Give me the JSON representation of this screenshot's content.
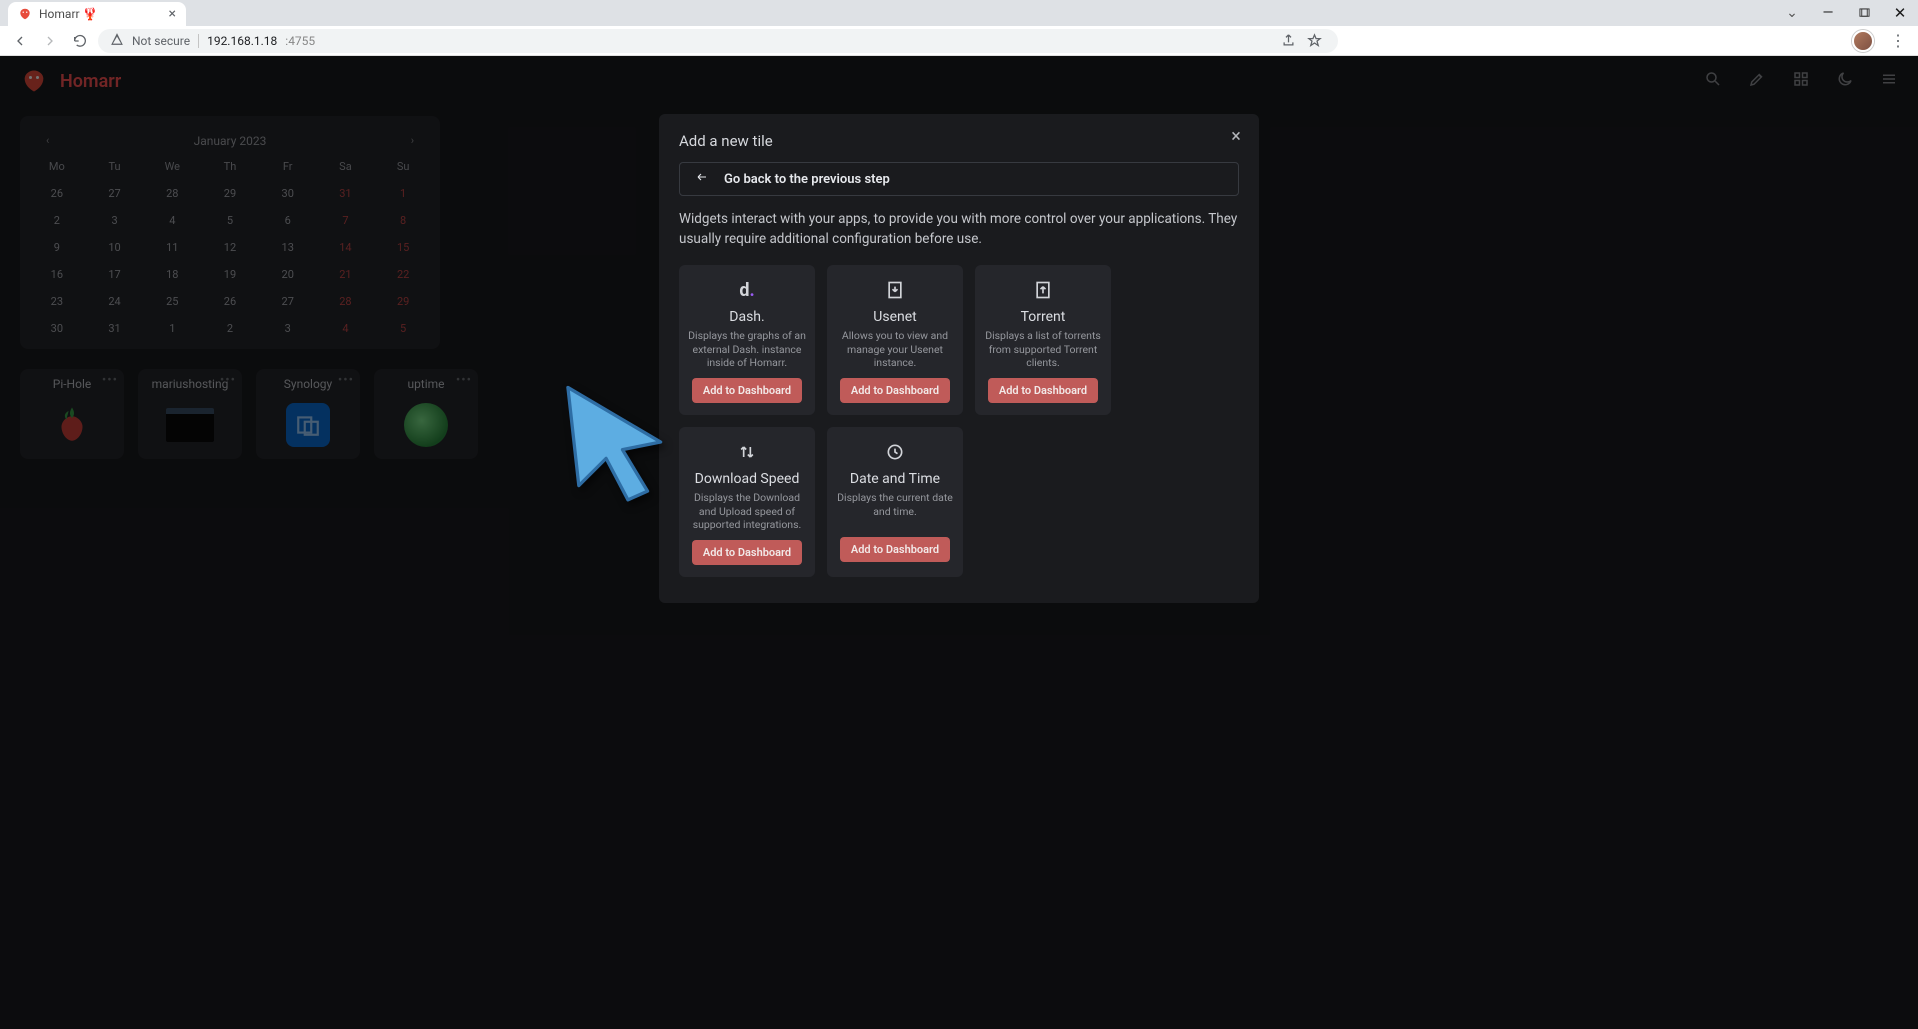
{
  "browser": {
    "tab_title": "Homarr 🦞",
    "security_label": "Not secure",
    "address_host": "192.168.1.18",
    "address_port": ":4755"
  },
  "header": {
    "brand": "Homarr",
    "search_placeholder": "Search"
  },
  "calendar": {
    "title": "January 2023",
    "days_of_week": [
      "Mo",
      "Tu",
      "We",
      "Th",
      "Fr",
      "Sa",
      "Su"
    ],
    "cells": [
      {
        "n": "26"
      },
      {
        "n": "27"
      },
      {
        "n": "28"
      },
      {
        "n": "29"
      },
      {
        "n": "30"
      },
      {
        "n": "31",
        "we": true
      },
      {
        "n": "1",
        "we": true
      },
      {
        "n": "2"
      },
      {
        "n": "3"
      },
      {
        "n": "4"
      },
      {
        "n": "5"
      },
      {
        "n": "6"
      },
      {
        "n": "7",
        "we": true
      },
      {
        "n": "8",
        "we": true
      },
      {
        "n": "9"
      },
      {
        "n": "10"
      },
      {
        "n": "11"
      },
      {
        "n": "12"
      },
      {
        "n": "13"
      },
      {
        "n": "14",
        "we": true
      },
      {
        "n": "15",
        "we": true
      },
      {
        "n": "16"
      },
      {
        "n": "17"
      },
      {
        "n": "18"
      },
      {
        "n": "19"
      },
      {
        "n": "20"
      },
      {
        "n": "21",
        "we": true
      },
      {
        "n": "22",
        "we": true
      },
      {
        "n": "23"
      },
      {
        "n": "24"
      },
      {
        "n": "25"
      },
      {
        "n": "26"
      },
      {
        "n": "27"
      },
      {
        "n": "28",
        "we": true
      },
      {
        "n": "29",
        "we": true
      },
      {
        "n": "30"
      },
      {
        "n": "31"
      },
      {
        "n": "1"
      },
      {
        "n": "2"
      },
      {
        "n": "3"
      },
      {
        "n": "4",
        "we": true
      },
      {
        "n": "5",
        "we": true
      }
    ]
  },
  "apps": [
    {
      "name": "Pi-Hole"
    },
    {
      "name": "mariushosting"
    },
    {
      "name": "Synology"
    },
    {
      "name": "uptime"
    }
  ],
  "modal": {
    "title": "Add a new tile",
    "back": "Go back to the previous step",
    "description": "Widgets interact with your apps, to provide you with more control over your applications. They usually require additional configuration before use.",
    "add_label": "Add to Dashboard",
    "widgets": [
      {
        "id": "dash",
        "title": "Dash.",
        "desc": "Displays the graphs of an external Dash. instance inside of Homarr."
      },
      {
        "id": "usenet",
        "title": "Usenet",
        "desc": "Allows you to view and manage your Usenet instance."
      },
      {
        "id": "torrent",
        "title": "Torrent",
        "desc": "Displays a list of torrents from supported Torrent clients."
      },
      {
        "id": "speed",
        "title": "Download Speed",
        "desc": "Displays the Download and Upload speed of supported integrations."
      },
      {
        "id": "datetime",
        "title": "Date and Time",
        "desc": "Displays the current date and time."
      }
    ]
  }
}
